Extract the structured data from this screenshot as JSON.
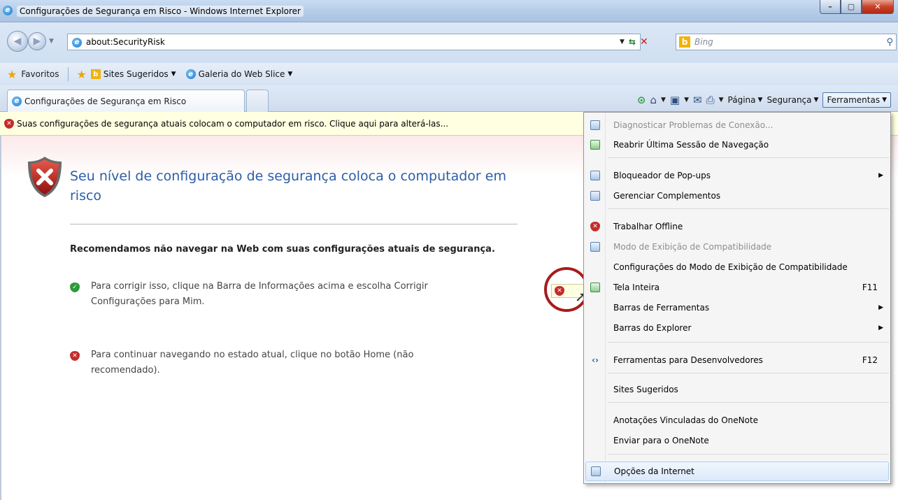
{
  "window": {
    "title": "Configurações de Segurança em Risco - Windows Internet Explorer",
    "min_glyph": "–",
    "max_glyph": "▢",
    "close_glyph": "✕"
  },
  "address": {
    "url": "about:SecurityRisk",
    "search_placeholder": "Bing",
    "back_glyph": "◀",
    "fwd_glyph": "▶"
  },
  "favorites": {
    "label": "Favoritos",
    "items": [
      {
        "label": "Sites Sugeridos"
      },
      {
        "label": "Galeria do Web Slice"
      }
    ]
  },
  "tabs": {
    "active_label": "Configurações de Segurança em Risco"
  },
  "commandbar": {
    "page": "Página",
    "security": "Segurança",
    "tools": "Ferramentas"
  },
  "infobar": {
    "message": "Suas configurações de segurança atuais colocam o computador em risco. Clique aqui para alterá-las..."
  },
  "content": {
    "headline": "Seu nível de configuração de segurança coloca o computador em risco",
    "recommend": "Recomendamos não navegar na Web com suas configurações atuais de segurança.",
    "bullet1": "Para corrigir isso, clique na Barra de Informações acima e escolha Corrigir Configurações para Mim.",
    "bullet2": "Para continuar navegando no estado atual, clique no botão Home (não recomendado)."
  },
  "menu": {
    "items": [
      {
        "label": "Diagnosticar Problemas de Conexão...",
        "shortcut": "",
        "disabled": true
      },
      {
        "label": "Reabrir Última Sessão de Navegação",
        "shortcut": ""
      },
      {
        "label": "Bloqueador de Pop-ups",
        "shortcut": ""
      },
      {
        "label": "Gerenciar Complementos",
        "shortcut": ""
      },
      {
        "label": "Trabalhar Offline",
        "shortcut": ""
      },
      {
        "label": "Modo de Exibição de Compatibilidade",
        "shortcut": "",
        "disabled": true
      },
      {
        "label": "Configurações do Modo de Exibição de Compatibilidade",
        "shortcut": ""
      },
      {
        "label": "Tela Inteira",
        "shortcut": "F11"
      },
      {
        "label": "Barras de Ferramentas",
        "shortcut": ""
      },
      {
        "label": "Barras do Explorer",
        "shortcut": ""
      },
      {
        "label": "Ferramentas para Desenvolvedores",
        "shortcut": "F12"
      },
      {
        "label": "Sites Sugeridos",
        "shortcut": ""
      },
      {
        "label": "Anotações Vinculadas do OneNote",
        "shortcut": ""
      },
      {
        "label": "Enviar para o OneNote",
        "shortcut": ""
      },
      {
        "label": "Opções da Internet",
        "shortcut": ""
      }
    ]
  }
}
